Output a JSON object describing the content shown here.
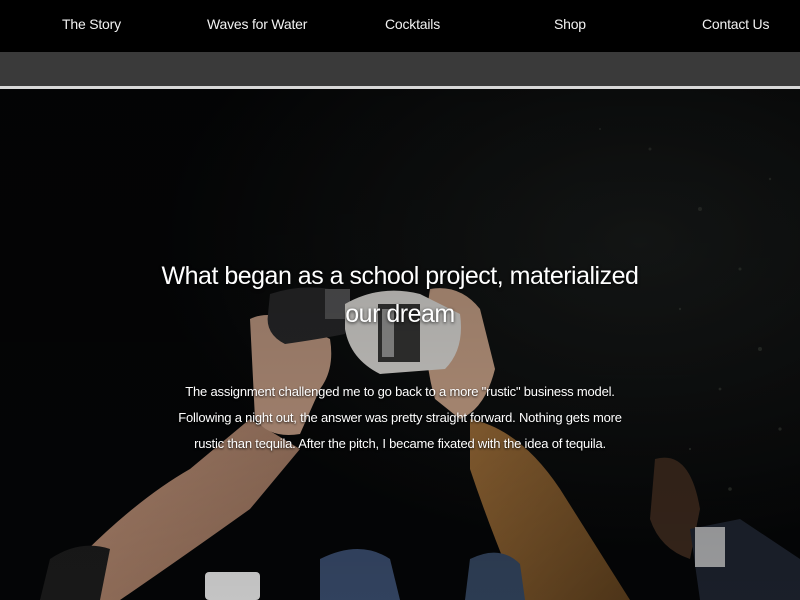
{
  "nav": {
    "items": [
      {
        "label": "The Story"
      },
      {
        "label": "Waves for Water"
      },
      {
        "label": "Cocktails"
      },
      {
        "label": "Shop"
      },
      {
        "label": "Contact Us"
      }
    ]
  },
  "hero": {
    "title": "What began as a school project, materialized our dream",
    "body": "The assignment challenged me to go back to a more \"rustic\" business model. Following a night out, the answer was pretty straight forward. Nothing gets more rustic than tequila. After the pitch, I became fixated with the idea of tequila.",
    "image_description_icon": "hands-toasting-bottles-photo"
  },
  "colors": {
    "nav_bg": "#000000",
    "subbar_bg": "#3a3a3a",
    "divider": "#d8d8d8",
    "text": "#ffffff"
  }
}
